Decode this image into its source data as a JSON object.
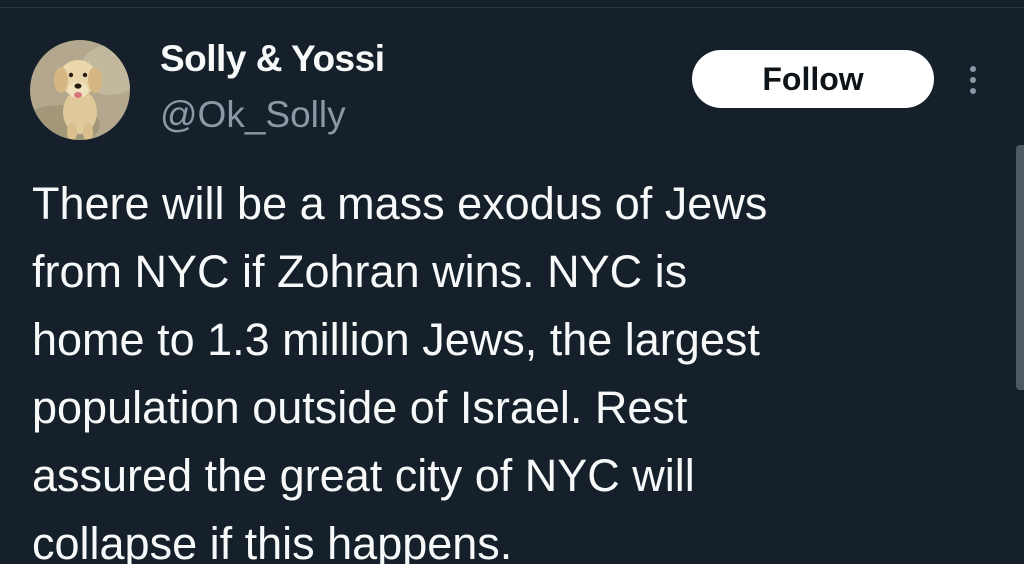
{
  "author": {
    "display_name": "Solly & Yossi",
    "handle": "@Ok_Solly",
    "avatar_icon": "golden-retriever-avatar"
  },
  "actions": {
    "follow_label": "Follow",
    "more_icon": "more-vertical-icon"
  },
  "tweet": {
    "lines": [
      "There will be a mass exodus of Jews",
      "from NYC if Zohran wins. NYC is",
      "home to 1.3 million Jews, the largest",
      "population outside of Israel. Rest",
      "assured the great city of NYC will",
      "collapse if this happens."
    ]
  },
  "colors": {
    "background": "#15202b",
    "text": "#f7f9f9",
    "secondary_text": "#8b98a5",
    "follow_bg": "#ffffff"
  }
}
